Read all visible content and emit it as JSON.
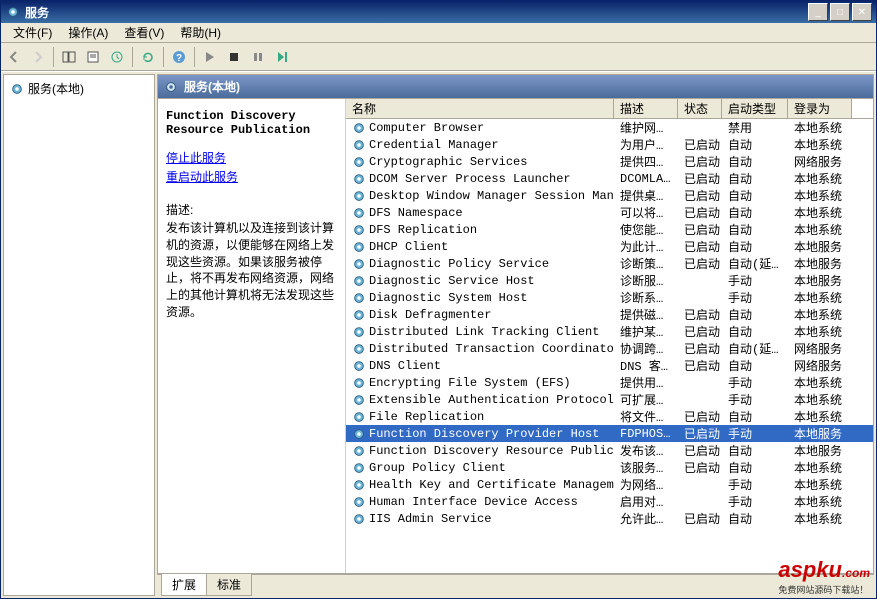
{
  "window": {
    "title": "服务"
  },
  "menu": {
    "file": "文件(F)",
    "action": "操作(A)",
    "view": "查看(V)",
    "help": "帮助(H)"
  },
  "tree": {
    "root": "服务(本地)"
  },
  "header": {
    "title": "服务(本地)"
  },
  "info": {
    "service_name": "Function Discovery Resource Publication",
    "stop_link": "停止此服务",
    "restart_link": "重启动此服务",
    "desc_label": "描述:",
    "desc_text": "发布该计算机以及连接到该计算机的资源，以便能够在网络上发现这些资源。如果该服务被停止，将不再发布网络资源，网络上的其他计算机将无法发现这些资源。"
  },
  "columns": {
    "name": "名称",
    "desc": "描述",
    "status": "状态",
    "startup": "启动类型",
    "logon": "登录为"
  },
  "tabs": {
    "extended": "扩展",
    "standard": "标准"
  },
  "selected_index": 18,
  "services": [
    {
      "name": "Computer Browser",
      "desc": "维护网…",
      "status": "",
      "startup": "禁用",
      "logon": "本地系统"
    },
    {
      "name": "Credential Manager",
      "desc": "为用户…",
      "status": "已启动",
      "startup": "自动",
      "logon": "本地系统"
    },
    {
      "name": "Cryptographic Services",
      "desc": "提供四…",
      "status": "已启动",
      "startup": "自动",
      "logon": "网络服务"
    },
    {
      "name": "DCOM Server Process Launcher",
      "desc": "DCOMLA…",
      "status": "已启动",
      "startup": "自动",
      "logon": "本地系统"
    },
    {
      "name": "Desktop Window Manager Session Manager",
      "desc": "提供桌…",
      "status": "已启动",
      "startup": "自动",
      "logon": "本地系统"
    },
    {
      "name": "DFS Namespace",
      "desc": "可以将…",
      "status": "已启动",
      "startup": "自动",
      "logon": "本地系统"
    },
    {
      "name": "DFS Replication",
      "desc": "使您能…",
      "status": "已启动",
      "startup": "自动",
      "logon": "本地系统"
    },
    {
      "name": "DHCP Client",
      "desc": "为此计…",
      "status": "已启动",
      "startup": "自动",
      "logon": "本地服务"
    },
    {
      "name": "Diagnostic Policy Service",
      "desc": "诊断策…",
      "status": "已启动",
      "startup": "自动(延…",
      "logon": "本地服务"
    },
    {
      "name": "Diagnostic Service Host",
      "desc": "诊断服…",
      "status": "",
      "startup": "手动",
      "logon": "本地服务"
    },
    {
      "name": "Diagnostic System Host",
      "desc": "诊断系…",
      "status": "",
      "startup": "手动",
      "logon": "本地系统"
    },
    {
      "name": "Disk Defragmenter",
      "desc": "提供磁…",
      "status": "已启动",
      "startup": "自动",
      "logon": "本地系统"
    },
    {
      "name": "Distributed Link Tracking Client",
      "desc": "维护某…",
      "status": "已启动",
      "startup": "自动",
      "logon": "本地系统"
    },
    {
      "name": "Distributed Transaction Coordinator",
      "desc": "协调跨…",
      "status": "已启动",
      "startup": "自动(延…",
      "logon": "网络服务"
    },
    {
      "name": "DNS Client",
      "desc": "DNS 客…",
      "status": "已启动",
      "startup": "自动",
      "logon": "网络服务"
    },
    {
      "name": "Encrypting File System (EFS)",
      "desc": "提供用…",
      "status": "",
      "startup": "手动",
      "logon": "本地系统"
    },
    {
      "name": "Extensible Authentication Protocol",
      "desc": "可扩展…",
      "status": "",
      "startup": "手动",
      "logon": "本地系统"
    },
    {
      "name": "File Replication",
      "desc": "将文件…",
      "status": "已启动",
      "startup": "自动",
      "logon": "本地系统"
    },
    {
      "name": "Function Discovery Provider Host",
      "desc": "FDPHOS…",
      "status": "已启动",
      "startup": "手动",
      "logon": "本地服务"
    },
    {
      "name": "Function Discovery Resource Publication",
      "desc": "发布该…",
      "status": "已启动",
      "startup": "自动",
      "logon": "本地服务"
    },
    {
      "name": "Group Policy Client",
      "desc": "该服务…",
      "status": "已启动",
      "startup": "自动",
      "logon": "本地系统"
    },
    {
      "name": "Health Key and Certificate Management",
      "desc": "为网络…",
      "status": "",
      "startup": "手动",
      "logon": "本地系统"
    },
    {
      "name": "Human Interface Device Access",
      "desc": "启用对…",
      "status": "",
      "startup": "手动",
      "logon": "本地系统"
    },
    {
      "name": "IIS Admin Service",
      "desc": "允许此…",
      "status": "已启动",
      "startup": "自动",
      "logon": "本地系统"
    }
  ],
  "watermark": {
    "main": "aspku",
    "sub": "免费网站源码下载站！",
    "tld": ".com"
  }
}
